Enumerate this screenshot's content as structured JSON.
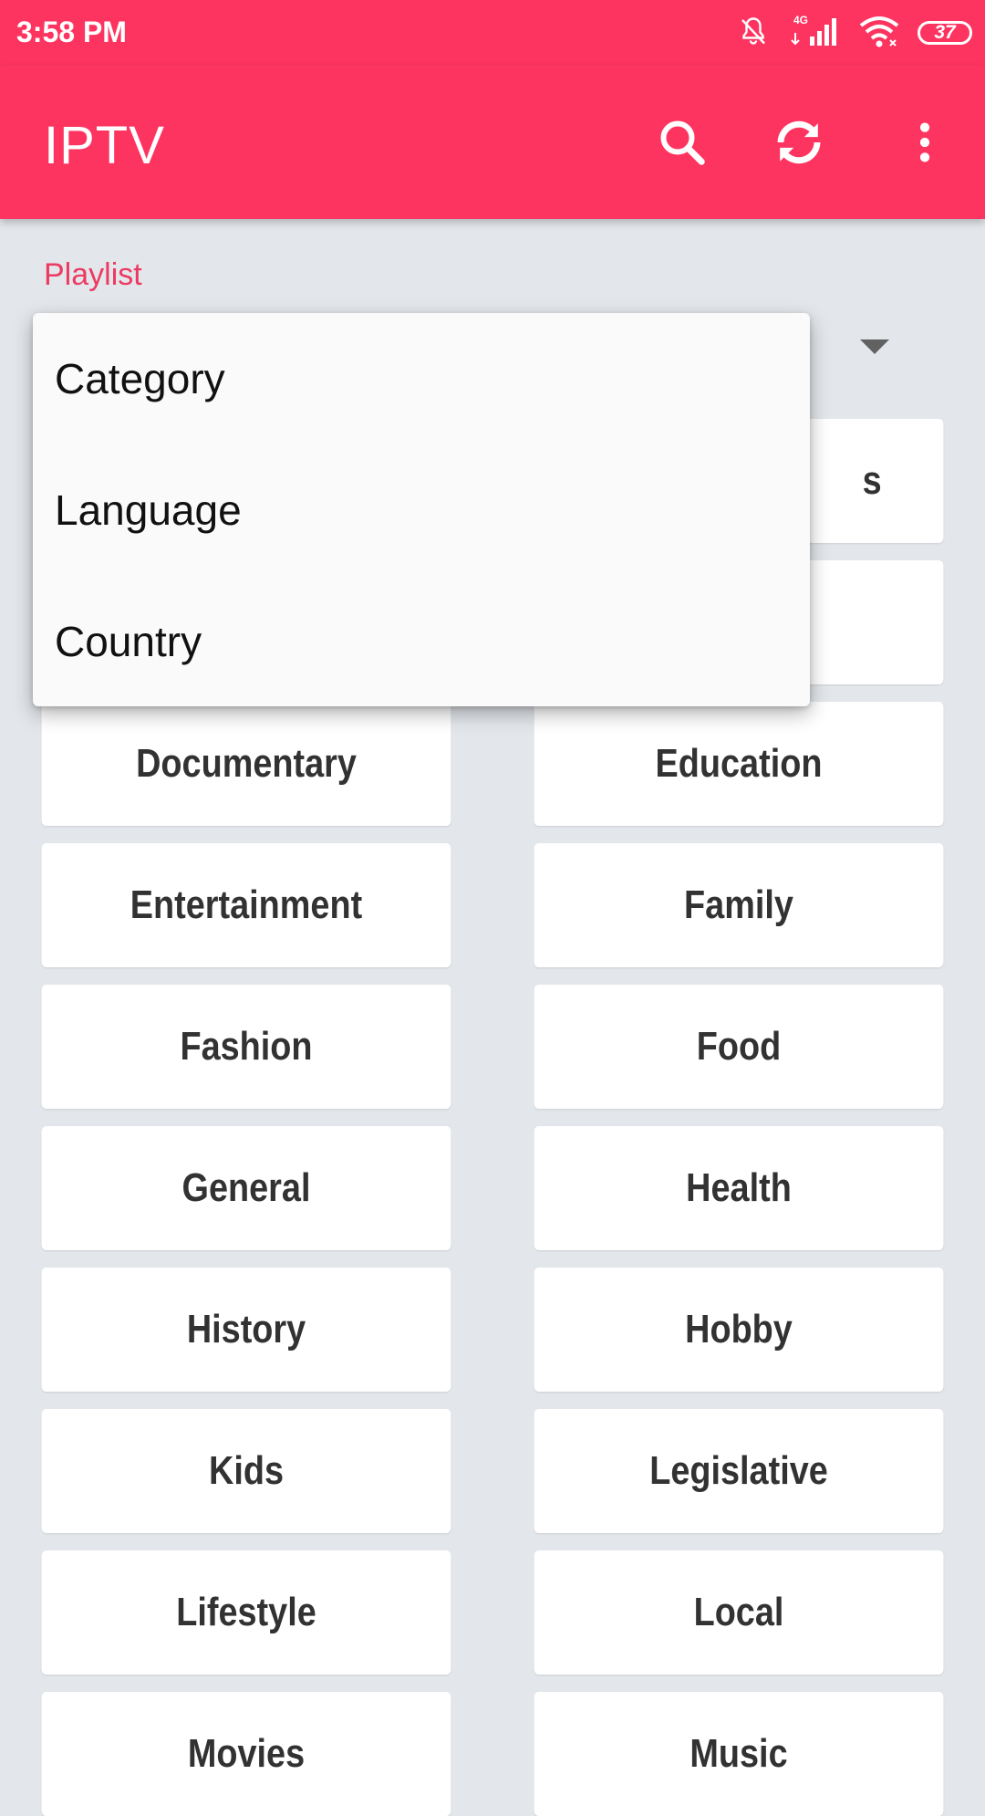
{
  "status_bar": {
    "time": "3:58 PM",
    "network": "4G",
    "battery": "37"
  },
  "app_bar": {
    "title": "IPTV",
    "actions": [
      "search-icon",
      "sync-icon",
      "more-vert-icon"
    ]
  },
  "playlist": {
    "label": "Playlist"
  },
  "menu": {
    "items": [
      "Category",
      "Language",
      "Country"
    ]
  },
  "grid": {
    "partial_visible": [
      "s"
    ],
    "rows": [
      [
        "Documentary",
        "Education"
      ],
      [
        "Entertainment",
        "Family"
      ],
      [
        "Fashion",
        "Food"
      ],
      [
        "General",
        "Health"
      ],
      [
        "History",
        "Hobby"
      ],
      [
        "Kids",
        "Legislative"
      ],
      [
        "Lifestyle",
        "Local"
      ],
      [
        "Movies",
        "Music"
      ]
    ]
  },
  "colors": {
    "accent": "#fd3460",
    "label": "#ec3b63",
    "background": "#e3e7eb",
    "cell_text": "#323232"
  }
}
